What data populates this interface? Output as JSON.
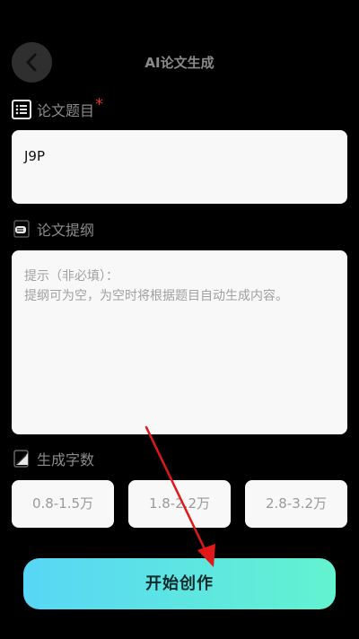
{
  "header": {
    "title": "AI论文生成",
    "back_icon": "chevron-left-icon"
  },
  "topic": {
    "label": "论文题目",
    "required_mark": "*",
    "icon": "list-icon",
    "value": "J9P"
  },
  "outline": {
    "label": "论文提纲",
    "icon": "notes-icon",
    "placeholder_line1": "提示（非必填）：",
    "placeholder_line2": "提纲可为空，为空时将根据题目自动生成内容。"
  },
  "word_count": {
    "label": "生成字数",
    "icon": "edit-doc-icon",
    "options": [
      "0.8-1.5万",
      "1.8-2.2万",
      "2.8-3.2万"
    ]
  },
  "actions": {
    "start_label": "开始创作"
  },
  "colors": {
    "background": "#000000",
    "card": "#f8f8f8",
    "button_gradient_start": "#58d6f6",
    "button_gradient_end": "#62f3cf",
    "required": "#e03030",
    "annotation_arrow": "#e01818"
  }
}
